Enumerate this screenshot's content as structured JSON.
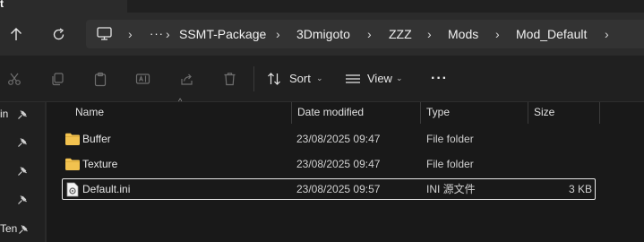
{
  "window": {
    "left_tab_text": "t"
  },
  "nav": {
    "up_icon": "arrow-up-icon",
    "refresh_icon": "refresh-icon"
  },
  "address": {
    "monitor_icon": "monitor-icon",
    "overflow": "···",
    "crumbs": [
      "SSMT-Package",
      "3Dmigoto",
      "ZZZ",
      "Mods",
      "Mod_Default"
    ]
  },
  "toolbar": {
    "sort_label": "Sort",
    "view_label": "View",
    "more_label": "···"
  },
  "navpane": {
    "items": [
      "in",
      "",
      "",
      "",
      "Ten"
    ]
  },
  "columns": {
    "name": "Name",
    "date": "Date modified",
    "type": "Type",
    "size": "Size"
  },
  "files": [
    {
      "name": "Buffer",
      "date": "23/08/2025 09:47",
      "type": "File folder",
      "size": "",
      "icon": "folder-icon"
    },
    {
      "name": "Texture",
      "date": "23/08/2025 09:47",
      "type": "File folder",
      "size": "",
      "icon": "folder-icon"
    },
    {
      "name": "Default.ini",
      "date": "23/08/2025 09:57",
      "type": "INI 源文件",
      "size": "3 KB",
      "icon": "ini-file-icon"
    }
  ],
  "colors": {
    "folder": "#f2c24f",
    "accent_border": "#e8e8e8",
    "toolbar_bg": "#202020",
    "list_bg": "#191919"
  }
}
